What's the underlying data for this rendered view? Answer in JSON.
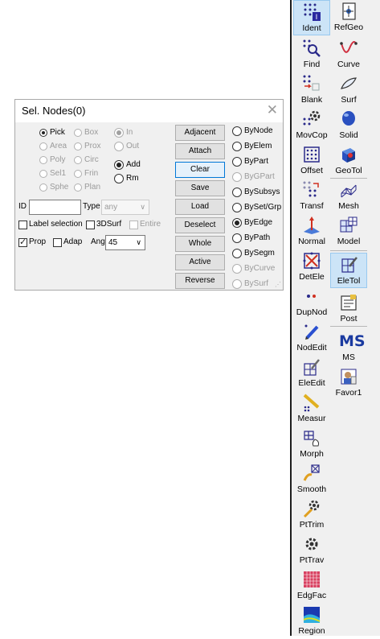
{
  "dialog": {
    "title": "Sel. Nodes(0)",
    "close_glyph": "✕",
    "col1": [
      {
        "label": "Pick",
        "selected": true,
        "enabled": true
      },
      {
        "label": "Area",
        "selected": false,
        "enabled": false
      },
      {
        "label": "Poly",
        "selected": false,
        "enabled": false
      },
      {
        "label": "Sel1",
        "selected": false,
        "enabled": false
      },
      {
        "label": "Sphe",
        "selected": false,
        "enabled": false
      }
    ],
    "col2": [
      {
        "label": "Box",
        "selected": false,
        "enabled": false
      },
      {
        "label": "Prox",
        "selected": false,
        "enabled": false
      },
      {
        "label": "Circ",
        "selected": false,
        "enabled": false
      },
      {
        "label": "Frin",
        "selected": false,
        "enabled": false
      },
      {
        "label": "Plan",
        "selected": false,
        "enabled": false
      }
    ],
    "col3": [
      {
        "label": "In",
        "selected": true,
        "enabled": false
      },
      {
        "label": "Out",
        "selected": false,
        "enabled": false
      }
    ],
    "mode": [
      {
        "label": "Add",
        "selected": true
      },
      {
        "label": "Rm",
        "selected": false
      }
    ],
    "id_label": "ID",
    "id_value": "",
    "type_label": "Type",
    "type_value": "any",
    "checks": {
      "label_selection": {
        "label": "Label selection",
        "checked": false
      },
      "surf3d": {
        "label": "3DSurf",
        "checked": false
      },
      "entire": {
        "label": "Entire",
        "checked": false
      },
      "prop": {
        "label": "Prop",
        "checked": true
      },
      "adap": {
        "label": "Adap",
        "checked": false
      }
    },
    "ang_label": "Ang",
    "ang_value": "45",
    "buttons": [
      "Adjacent",
      "Attach",
      "Clear",
      "Save",
      "Load",
      "Deselect",
      "Whole",
      "Active",
      "Reverse"
    ],
    "focused_button": "Clear",
    "by_options": [
      {
        "label": "ByNode",
        "selected": false,
        "enabled": true
      },
      {
        "label": "ByElem",
        "selected": false,
        "enabled": true
      },
      {
        "label": "ByPart",
        "selected": false,
        "enabled": true
      },
      {
        "label": "ByGPart",
        "selected": false,
        "enabled": false
      },
      {
        "label": "BySubsys",
        "selected": false,
        "enabled": true
      },
      {
        "label": "BySet/Grp",
        "selected": false,
        "enabled": true
      },
      {
        "label": "ByEdge",
        "selected": true,
        "enabled": true
      },
      {
        "label": "ByPath",
        "selected": false,
        "enabled": true
      },
      {
        "label": "BySegm",
        "selected": false,
        "enabled": true
      },
      {
        "label": "ByCurve",
        "selected": false,
        "enabled": false
      },
      {
        "label": "BySurf",
        "selected": false,
        "enabled": false
      }
    ]
  },
  "toolbar": {
    "left": [
      "Ident",
      "Find",
      "Blank",
      "MovCop",
      "Offset",
      "Transf",
      "Normal",
      "DetEle",
      "DupNod",
      "NodEdit",
      "EleEdit",
      "Measur",
      "Morph",
      "Smooth",
      "PtTrim",
      "PtTrav",
      "EdgFac",
      "Region"
    ],
    "right": [
      "RefGeo",
      "Curve",
      "Surf",
      "Solid",
      "GeoTol",
      "Mesh",
      "Model",
      "EleTol",
      "Post",
      "MS",
      "Favor1"
    ],
    "ms_glyph": "MS",
    "selected": [
      "Ident",
      "EleTol"
    ]
  }
}
